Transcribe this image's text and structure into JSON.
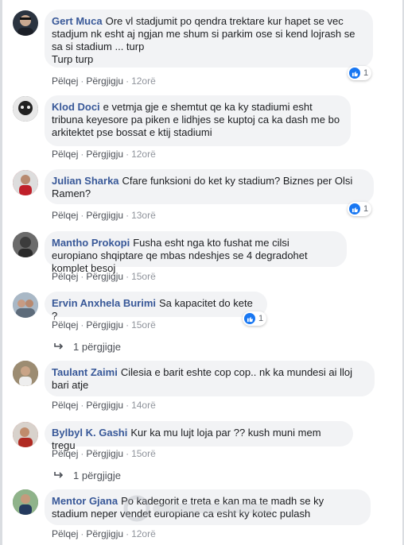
{
  "labels": {
    "like": "Pëlqej",
    "reply": "Përgjigju",
    "dot": "·"
  },
  "comments": [
    {
      "name": "Gert Muca",
      "text": "Ore vl stadjumit po qendra trektare kur hapet se vec stadjum nk esht aj ngjan me shum si parkim ose si kend lojrash se sa si stadium ... turp\nTurp turp",
      "time": "12orë",
      "reaction_count": "1",
      "avatar_color": "#2b3440"
    },
    {
      "name": "Klod Doci",
      "text": "e vetmja gje e shemtut qe ka ky stadiumi esht tribuna keyesore pa piken e lidhjes se kuptoj ca ka dash me bo arkitektet pse bossat e ktij stadiumi",
      "time": "12orë",
      "reaction_count": "",
      "avatar_color": "#3a3a3a"
    },
    {
      "name": "Julian Sharka",
      "text": "Cfare funksioni do ket ky stadium? Biznes per Olsi Ramen?",
      "time": "13orë",
      "reaction_count": "1",
      "avatar_color": "#b0262b"
    },
    {
      "name": "Mantho Prokopi",
      "text": "Fusha esht nga kto fushat me cilsi europiano shqiptare qe mbas ndeshjes se 4 degradohet komplet besoj",
      "time": "15orë",
      "reaction_count": "",
      "avatar_color": "#4a4a4a"
    },
    {
      "name": "Ervin Anxhela Burimi",
      "text": "Sa kapacitet do kete ?",
      "time": "15orë",
      "reaction_count": "1",
      "avatar_color": "#8fa0b3"
    },
    {
      "name": "Taulant Zaimi",
      "text": "Cilesia e barit eshte cop cop.. nk ka mundesi ai lloj bari atje",
      "time": "14orë",
      "reaction_count": "",
      "avatar_color": "#7a6a55"
    },
    {
      "name": "Bylbyl K. Gashi",
      "text": "Kur ka mu lujt loja par ?? kush muni mem tregu",
      "time": "15orë",
      "reaction_count": "",
      "avatar_color": "#b33a2f"
    },
    {
      "name": "Mentor Gjana",
      "text": "Po kadegorit e treta e kan ma te madh se ky stadium neper vendet europiane ca esht ky kotec pulash",
      "time": "12orë",
      "reaction_count": "",
      "avatar_color": "#4f6f4a"
    }
  ],
  "replies": [
    {
      "label": "1 përgjigje"
    },
    {
      "label": "1 përgjigje"
    }
  ],
  "colors": {
    "name": "#385898",
    "bubble": "#f2f3f5",
    "like": "#1877f2"
  }
}
